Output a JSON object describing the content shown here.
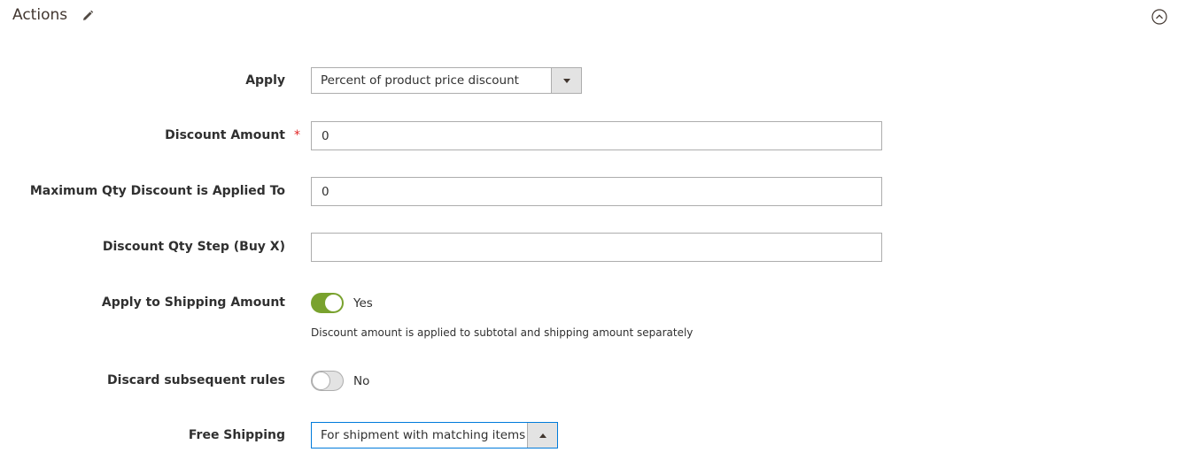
{
  "section": {
    "title": "Actions",
    "edit_icon": "pencil-icon",
    "collapse_icon": "chevron-up-circle-icon"
  },
  "fields": {
    "apply": {
      "label": "Apply",
      "value": "Percent of product price discount"
    },
    "discount_amount": {
      "label": "Discount Amount",
      "required_mark": "*",
      "value": "0"
    },
    "max_qty": {
      "label": "Maximum Qty Discount is Applied To",
      "value": "0"
    },
    "qty_step": {
      "label": "Discount Qty Step (Buy X)",
      "value": ""
    },
    "apply_shipping": {
      "label": "Apply to Shipping Amount",
      "state": "Yes",
      "on": true,
      "note": "Discount amount is applied to subtotal and shipping amount separately"
    },
    "discard_rules": {
      "label": "Discard subsequent rules",
      "state": "No",
      "on": false
    },
    "free_shipping": {
      "label": "Free Shipping",
      "value": "For shipment with matching items"
    }
  },
  "colors": {
    "toggle_on": "#79a22e",
    "required": "#e22626",
    "focus_border": "#007bdb"
  }
}
